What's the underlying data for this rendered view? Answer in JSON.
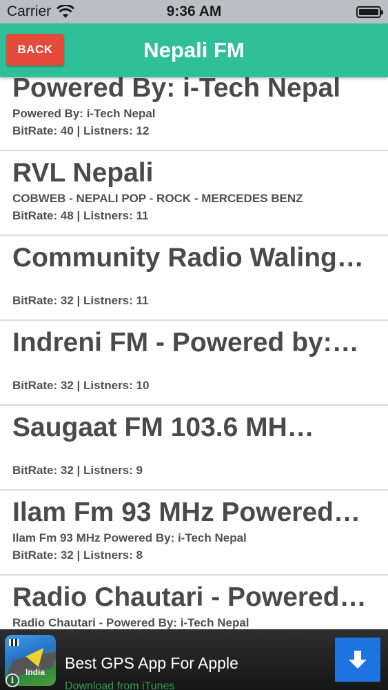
{
  "status_bar": {
    "carrier": "Carrier",
    "time": "9:36 AM"
  },
  "nav": {
    "back_label": "BACK",
    "title": "Nepali FM"
  },
  "stations": [
    {
      "name": "Powered By: i-Tech Nepal",
      "description": "Powered By: i-Tech Nepal",
      "stats": "BitRate: 40 | Listners: 12"
    },
    {
      "name": "RVL Nepali",
      "description": "COBWEB - NEPALI POP - ROCK - MERCEDES BENZ",
      "stats": "BitRate: 48 | Listners: 11"
    },
    {
      "name": "Community Radio Waling…",
      "description": "",
      "stats": "BitRate: 32 | Listners: 11"
    },
    {
      "name": "Indreni FM - Powered by:…",
      "description": "",
      "stats": "BitRate: 32 | Listners: 10"
    },
    {
      "name": "Saugaat FM 103.6 MH…",
      "description": "",
      "stats": "BitRate: 32 | Listners: 9"
    },
    {
      "name": "Ilam Fm 93 MHz Powered…",
      "description": "Ilam Fm 93 MHz Powered By: i-Tech Nepal",
      "stats": "BitRate: 32 | Listners: 8"
    },
    {
      "name": "Radio Chautari - Powered…",
      "description": "Radio Chautari - Powered By: i-Tech Nepal",
      "stats": ""
    }
  ],
  "ad": {
    "title": "Best GPS App For Apple",
    "subtitle": "Download from iTunes",
    "country": "India"
  },
  "colors": {
    "nav_bar": "#2fbf9b",
    "back_button": "#e44b3a",
    "download_button": "#1e73e0"
  }
}
